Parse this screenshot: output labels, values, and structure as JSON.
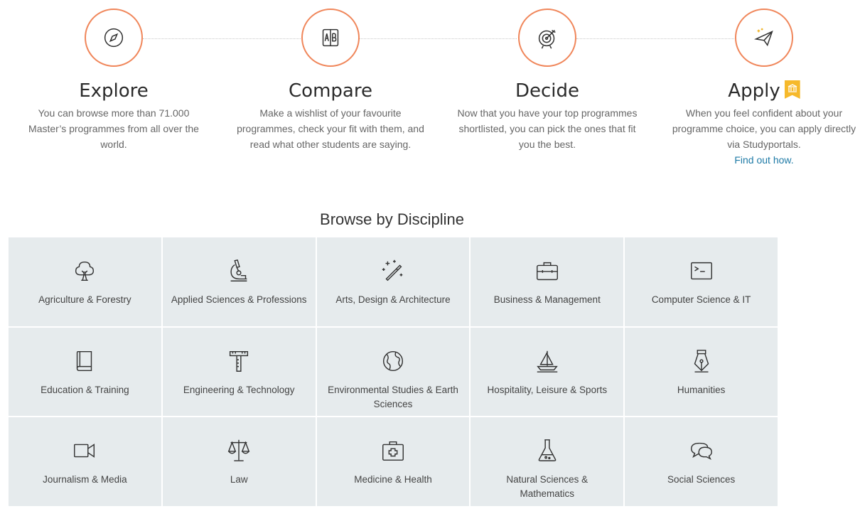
{
  "steps": [
    {
      "title": "Explore",
      "description": "You can browse more than 71.000 Master’s programmes from all over the world.",
      "icon": "compass-icon"
    },
    {
      "title": "Compare",
      "description": "Make a wishlist of your favourite programmes, check your fit with them, and read what other students are saying.",
      "icon": "ab-compare-icon"
    },
    {
      "title": "Decide",
      "description": "Now that you have your top programmes shortlisted, you can pick the ones that fit you the best.",
      "icon": "target-icon"
    },
    {
      "title": "Apply",
      "description": "When you feel confident about your programme choice, you can apply directly via Studyportals.",
      "link": "Find out how.",
      "icon": "paper-plane-icon"
    }
  ],
  "browse": {
    "title": "Browse by Discipline",
    "disciplines": [
      {
        "label": "Agriculture & Forestry",
        "icon": "tree-icon"
      },
      {
        "label": "Applied Sciences & Professions",
        "icon": "microscope-icon"
      },
      {
        "label": "Arts, Design & Architecture",
        "icon": "magic-wand-icon"
      },
      {
        "label": "Business & Management",
        "icon": "briefcase-icon"
      },
      {
        "label": "Computer Science & IT",
        "icon": "terminal-icon"
      },
      {
        "label": "Education & Training",
        "icon": "book-icon"
      },
      {
        "label": "Engineering & Technology",
        "icon": "t-square-icon"
      },
      {
        "label": "Environmental Studies & Earth Sciences",
        "icon": "globe-icon"
      },
      {
        "label": "Hospitality, Leisure & Sports",
        "icon": "sailboat-icon"
      },
      {
        "label": "Humanities",
        "icon": "fountain-pen-icon"
      },
      {
        "label": "Journalism & Media",
        "icon": "video-camera-icon"
      },
      {
        "label": "Law",
        "icon": "scales-icon"
      },
      {
        "label": "Medicine & Health",
        "icon": "first-aid-kit-icon"
      },
      {
        "label": "Natural Sciences & Mathematics",
        "icon": "flask-icon"
      },
      {
        "label": "Social Sciences",
        "icon": "speech-bubbles-icon"
      }
    ]
  },
  "colors": {
    "accent": "#f0865a",
    "link": "#1e7aa6",
    "badge": "#f6b92b",
    "tile_bg": "#e6ebed"
  }
}
